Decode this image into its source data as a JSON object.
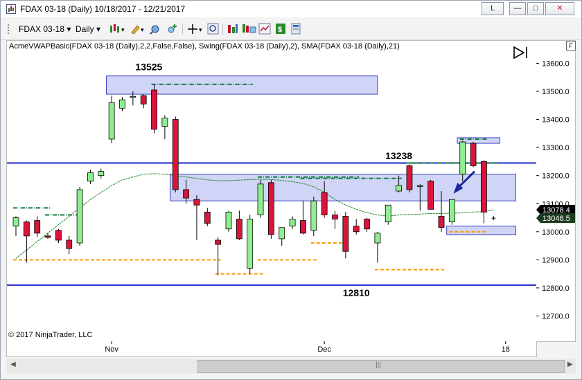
{
  "window": {
    "title": "FDAX 03-18 (Daily)  10/18/2017 - 12/21/2017",
    "link_button": "L",
    "minimize_symbol": "—",
    "maximize_symbol": "□",
    "close_symbol": "✕"
  },
  "toolbar": {
    "instrument": "FDAX 03-18",
    "interval": "Daily",
    "icons": [
      "bar-type-icon",
      "draw-pencil-icon",
      "indicators-icon",
      "add-drawing-icon",
      "crosshair-icon",
      "zoom-icon",
      "strategies-icon",
      "chart-properties-icon",
      "dollar-icon",
      "templates-icon"
    ]
  },
  "indicator_label": "AcmeVWAPBasic(FDAX 03-18 (Daily),2,2,False,False), Swing(FDAX 03-18 (Daily),2), SMA(FDAX 03-18 (Daily),21)",
  "copyright": "© 2017 NinjaTrader, LLC",
  "f_button": "F",
  "price_axis": {
    "ticks": [
      "13600.0",
      "13500.0",
      "13400.0",
      "13300.0",
      "13200.0",
      "13100.0",
      "13000.0",
      "12900.0",
      "12800.0",
      "12700.0"
    ],
    "last_price": "13078.4",
    "other_price": "13048.5",
    "last_price_color": "#000000",
    "other_price_color": "#1e3b1e"
  },
  "time_axis": {
    "labels": [
      "Nov",
      "Dec",
      "18"
    ]
  },
  "annotations": {
    "high_label": "13525",
    "mid_label": "13238",
    "low_label": "12810"
  },
  "scrollbar": {
    "left_arrow": "◀",
    "right_arrow": "▶",
    "thumb_grip": "|||"
  },
  "colors": {
    "up_candle": "#90ee90",
    "down_candle": "#dc143c",
    "zone_fill": "#c8cdf5",
    "zone_stroke": "#3a3fc0",
    "level_line": "#1a24c8",
    "swing_high": "#0b7a3c",
    "swing_low": "#ff9900",
    "sma": "#1f8a2a",
    "arrow": "#1a2aa0"
  },
  "chart_data": {
    "type": "candlestick",
    "ylim": [
      12610,
      13680
    ],
    "yticks": [
      13600,
      13500,
      13400,
      13300,
      13200,
      13100,
      13000,
      12900,
      12800,
      12700
    ],
    "candles": [
      {
        "o": 13020,
        "h": 13055,
        "l": 12985,
        "c": 13050
      },
      {
        "o": 13035,
        "h": 13040,
        "l": 12890,
        "c": 12985
      },
      {
        "o": 13040,
        "h": 13055,
        "l": 12980,
        "c": 12995
      },
      {
        "o": 12985,
        "h": 12995,
        "l": 12975,
        "c": 12980
      },
      {
        "o": 13005,
        "h": 13010,
        "l": 12960,
        "c": 12970
      },
      {
        "o": 12970,
        "h": 12985,
        "l": 12920,
        "c": 12940
      },
      {
        "o": 12960,
        "h": 13160,
        "l": 12950,
        "c": 13150
      },
      {
        "o": 13180,
        "h": 13220,
        "l": 13170,
        "c": 13210
      },
      {
        "o": 13200,
        "h": 13225,
        "l": 13190,
        "c": 13215
      },
      {
        "o": 13330,
        "h": 13485,
        "l": 13315,
        "c": 13460
      },
      {
        "o": 13440,
        "h": 13480,
        "l": 13430,
        "c": 13470
      },
      {
        "o": 13480,
        "h": 13500,
        "l": 13450,
        "c": 13482
      },
      {
        "o": 13485,
        "h": 13490,
        "l": 13440,
        "c": 13455
      },
      {
        "o": 13505,
        "h": 13525,
        "l": 13350,
        "c": 13365
      },
      {
        "o": 13375,
        "h": 13415,
        "l": 13330,
        "c": 13405
      },
      {
        "o": 13400,
        "h": 13410,
        "l": 13140,
        "c": 13150
      },
      {
        "o": 13150,
        "h": 13185,
        "l": 13100,
        "c": 13120
      },
      {
        "o": 13115,
        "h": 13130,
        "l": 12970,
        "c": 13095
      },
      {
        "o": 13070,
        "h": 13085,
        "l": 13020,
        "c": 13030
      },
      {
        "o": 12970,
        "h": 12980,
        "l": 12845,
        "c": 12955
      },
      {
        "o": 13010,
        "h": 13075,
        "l": 13000,
        "c": 13070
      },
      {
        "o": 13045,
        "h": 13075,
        "l": 12970,
        "c": 12975
      },
      {
        "o": 12870,
        "h": 13060,
        "l": 12850,
        "c": 13045
      },
      {
        "o": 13060,
        "h": 13185,
        "l": 13050,
        "c": 13170
      },
      {
        "o": 13175,
        "h": 13185,
        "l": 12975,
        "c": 12990
      },
      {
        "o": 12975,
        "h": 13010,
        "l": 12950,
        "c": 13015
      },
      {
        "o": 13020,
        "h": 13055,
        "l": 13010,
        "c": 13045
      },
      {
        "o": 13040,
        "h": 13110,
        "l": 12990,
        "c": 12995
      },
      {
        "o": 13005,
        "h": 13125,
        "l": 12985,
        "c": 13110
      },
      {
        "o": 13140,
        "h": 13180,
        "l": 13050,
        "c": 13060
      },
      {
        "o": 13060,
        "h": 13075,
        "l": 13010,
        "c": 13045
      },
      {
        "o": 13055,
        "h": 13070,
        "l": 12905,
        "c": 12930
      },
      {
        "o": 13020,
        "h": 13045,
        "l": 12990,
        "c": 13000
      },
      {
        "o": 13045,
        "h": 13050,
        "l": 13000,
        "c": 13010
      },
      {
        "o": 12960,
        "h": 13000,
        "l": 12890,
        "c": 12995
      },
      {
        "o": 13035,
        "h": 13090,
        "l": 13025,
        "c": 13095
      },
      {
        "o": 13145,
        "h": 13200,
        "l": 13140,
        "c": 13165
      },
      {
        "o": 13235,
        "h": 13240,
        "l": 13140,
        "c": 13150
      },
      {
        "o": 13165,
        "h": 13170,
        "l": 13075,
        "c": 13165
      },
      {
        "o": 13180,
        "h": 13185,
        "l": 13080,
        "c": 13080
      },
      {
        "o": 13055,
        "h": 13145,
        "l": 13000,
        "c": 13015
      },
      {
        "o": 13035,
        "h": 13100,
        "l": 13025,
        "c": 13115
      },
      {
        "o": 13205,
        "h": 13325,
        "l": 13180,
        "c": 13320
      },
      {
        "o": 13315,
        "h": 13320,
        "l": 13230,
        "c": 13235
      },
      {
        "o": 13250,
        "h": 13255,
        "l": 13030,
        "c": 13070
      }
    ],
    "sma_21": [
      12905,
      12935,
      12965,
      12995,
      13025,
      13055,
      13085,
      13115,
      13140,
      13165,
      13185,
      13195,
      13205,
      13207,
      13205,
      13200,
      13195,
      13190,
      13185,
      13182,
      13182,
      13184,
      13186,
      13187,
      13186,
      13183,
      13178,
      13172,
      13160,
      13140,
      13115,
      13095,
      13080,
      13068,
      13060,
      13055,
      13060,
      13062,
      13063,
      13065,
      13065,
      13066,
      13067,
      13070,
      13072,
      13078
    ],
    "swing_highs": [
      {
        "value": 13085,
        "from": 0,
        "to": 3
      },
      {
        "value": 13060,
        "from": 3,
        "to": 6
      },
      {
        "value": 13525,
        "from": 13,
        "to": 22
      },
      {
        "value": 13195,
        "from": 23,
        "to": 32
      },
      {
        "value": 13190,
        "from": 27,
        "to": 36
      },
      {
        "value": 13245,
        "from": 37,
        "to": 45
      },
      {
        "value": 13330,
        "from": 42,
        "to": 44
      }
    ],
    "swing_lows": [
      {
        "value": 12900,
        "from": 0,
        "to": 19
      },
      {
        "value": 12850,
        "from": 19,
        "to": 23
      },
      {
        "value": 12900,
        "from": 23,
        "to": 28
      },
      {
        "value": 12960,
        "from": 28,
        "to": 31
      },
      {
        "value": 12865,
        "from": 34,
        "to": 40
      },
      {
        "value": 13000,
        "from": 41,
        "to": 44
      }
    ],
    "horizontal_lines": [
      13245,
      12810
    ],
    "zones": [
      {
        "top": 13555,
        "bottom": 13490,
        "from": 8.5,
        "to": 34
      },
      {
        "top": 13205,
        "bottom": 13110,
        "from": 14.5,
        "to": 47
      },
      {
        "top": 13335,
        "bottom": 13315,
        "from": 41.5,
        "to": 45.5
      },
      {
        "top": 13020,
        "bottom": 12990,
        "from": 40.5,
        "to": 47
      }
    ],
    "text_labels": [
      {
        "key": "high_label",
        "price": 13575,
        "index": 12.5
      },
      {
        "key": "mid_label",
        "price": 13258,
        "index": 36
      },
      {
        "key": "low_label",
        "price": 12770,
        "index": 32
      }
    ]
  }
}
